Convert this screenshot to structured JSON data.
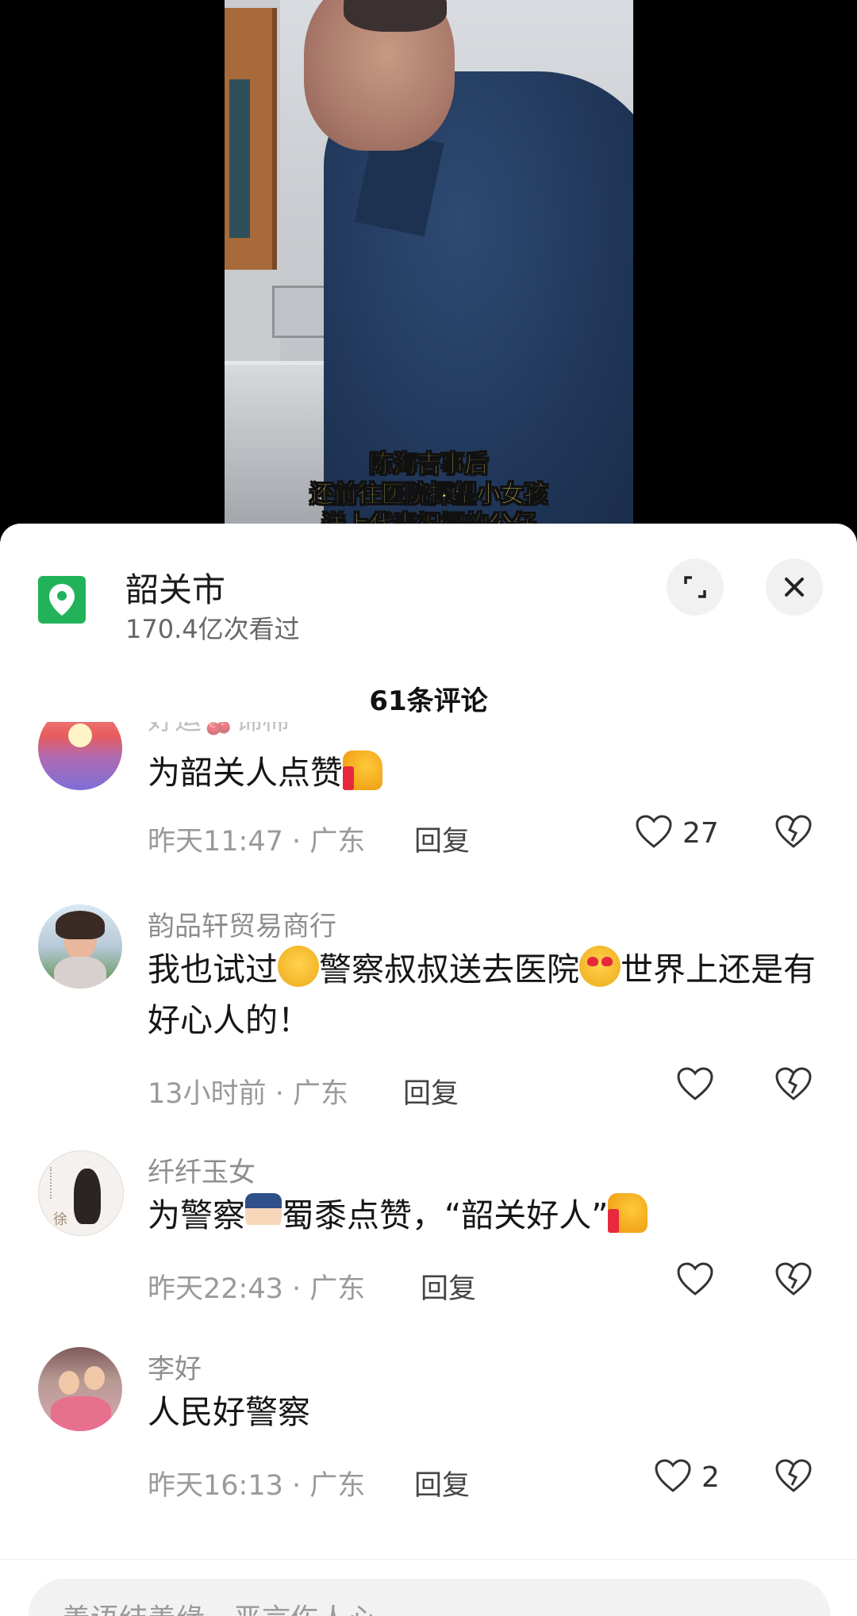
{
  "video": {
    "caption_lines": [
      "陈海吉事后",
      "还前往医院探望小女孩",
      "送上代表祝福的公仔"
    ]
  },
  "location": {
    "title": "韶关市",
    "views": "170.4亿次看过",
    "icon": "location-pin-icon",
    "accent_color": "#22b35a"
  },
  "comments_header": {
    "count_label": "61条评论"
  },
  "comments": [
    {
      "user": "好运🍒锦棉",
      "text": "为韶关人点赞",
      "time": "昨天11:47",
      "region": "广东",
      "reply_label": "回复",
      "likes": "27"
    },
    {
      "user": "韵品轩贸易商行",
      "text_parts": [
        "我也试过",
        "警察叔叔送去医院",
        "世界上还是有好心人的！"
      ],
      "time": "13小时前",
      "region": "广东",
      "reply_label": "回复",
      "likes": ""
    },
    {
      "user": "纤纤玉女",
      "text_parts": [
        "为警察",
        "蜀黍点赞，“韶关好人”"
      ],
      "time": "昨天22:43",
      "region": "广东",
      "reply_label": "回复",
      "likes": ""
    },
    {
      "user": "李好",
      "text": "人民好警察",
      "time": "昨天16:13",
      "region": "广东",
      "reply_label": "回复",
      "likes": "2"
    }
  ],
  "meta_separator": "·",
  "input": {
    "placeholder": "善语结善缘，恶言伤人心"
  }
}
